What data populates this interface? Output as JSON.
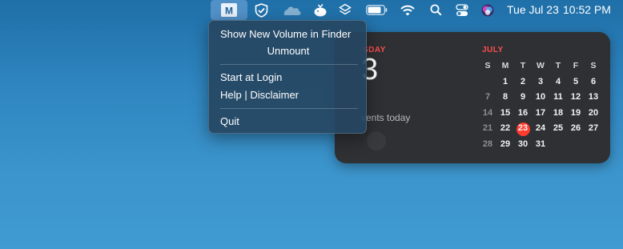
{
  "menubar": {
    "date": "Tue Jul 23",
    "time": "10:52 PM",
    "icons": [
      "mountain-duck-icon",
      "shield-check-icon",
      "cloud-icon",
      "cheese-icon",
      "stack-icon",
      "battery-icon",
      "wifi-icon",
      "search-icon",
      "control-center-icon",
      "siri-icon"
    ]
  },
  "app_icon_letter": "M",
  "menu": {
    "items": [
      "Show New Volume in Finder",
      "Unmount",
      "Start at Login",
      "Help | Disclaimer",
      "Quit"
    ]
  },
  "widget": {
    "day_label": "SDAY",
    "date_number": "3",
    "events_text": "vents today",
    "month": "JULY",
    "weekday_headers": [
      "S",
      "M",
      "T",
      "W",
      "T",
      "F",
      "S"
    ],
    "weeks": [
      [
        "",
        "1",
        "2",
        "3",
        "4",
        "5",
        "6"
      ],
      [
        "7",
        "8",
        "9",
        "10",
        "11",
        "12",
        "13"
      ],
      [
        "14",
        "15",
        "16",
        "17",
        "18",
        "19",
        "20"
      ],
      [
        "21",
        "22",
        "23",
        "24",
        "25",
        "26",
        "27"
      ],
      [
        "28",
        "29",
        "30",
        "31",
        "",
        "",
        ""
      ]
    ],
    "today": "23",
    "accent_color": "#ff3b30"
  }
}
